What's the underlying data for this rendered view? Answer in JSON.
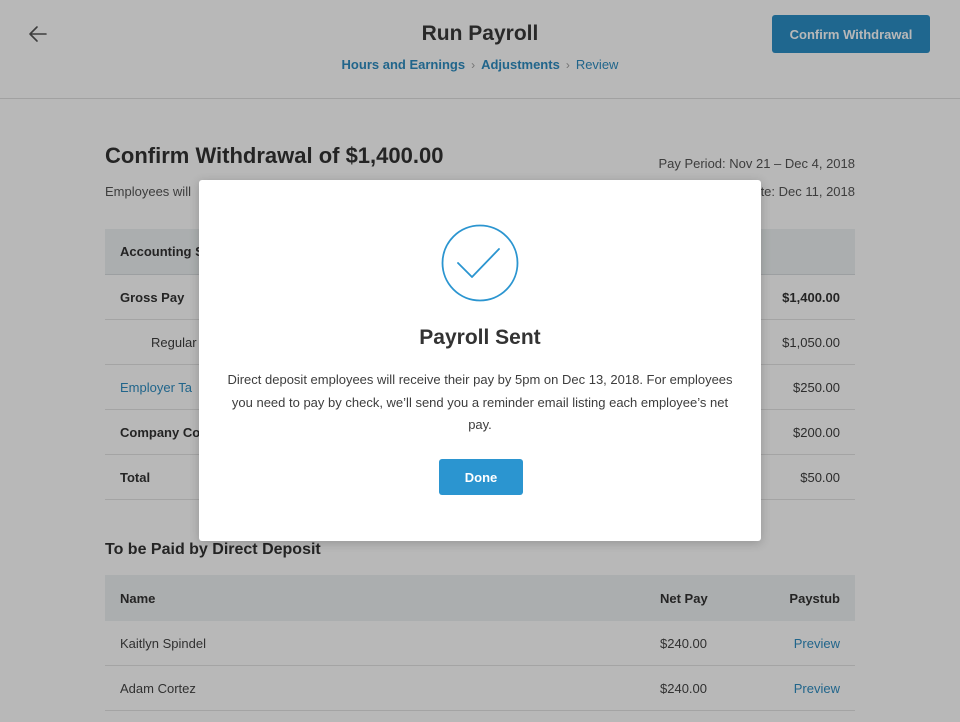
{
  "header": {
    "title": "Run Payroll",
    "breadcrumbs": [
      {
        "label": "Hours and Earnings"
      },
      {
        "label": "Adjustments"
      },
      {
        "label": "Review"
      }
    ],
    "confirm_button": "Confirm Withdrawal"
  },
  "summary": {
    "heading": "Confirm Withdrawal of $1,400.00",
    "subtext": "Employees will",
    "pay_period": "Pay Period: Nov 21 – Dec 4, 2018",
    "pay_date": "te: Dec 11, 2018"
  },
  "accounting_table": {
    "header": "Accounting S",
    "rows": [
      {
        "label": "Gross Pay",
        "value": "$1,400.00"
      },
      {
        "label": "Regular",
        "value": "$1,050.00"
      },
      {
        "label": "Employer Ta",
        "value": "$250.00"
      },
      {
        "label": "Company Co",
        "value": "$200.00"
      },
      {
        "label": "Total",
        "value": "$50.00"
      }
    ]
  },
  "direct_deposit": {
    "title": "To be Paid by Direct Deposit",
    "columns": {
      "name": "Name",
      "net_pay": "Net Pay",
      "paystub": "Paystub"
    },
    "rows": [
      {
        "name": "Kaitlyn Spindel",
        "net_pay": "$240.00",
        "paystub": "Preview"
      },
      {
        "name": "Adam Cortez",
        "net_pay": "$240.00",
        "paystub": "Preview"
      }
    ]
  },
  "modal": {
    "title": "Payroll Sent",
    "body": "Direct deposit employees will receive their pay by 5pm on Dec 13, 2018. For employees you need to pay by check, we’ll send you a reminder email listing each employee’s net pay.",
    "done_button": "Done",
    "icon": "checkmark-circle-icon"
  },
  "colors": {
    "accent": "#2b8fc7",
    "link": "#2e8dc1",
    "table_header_bg": "#eef1f3"
  }
}
